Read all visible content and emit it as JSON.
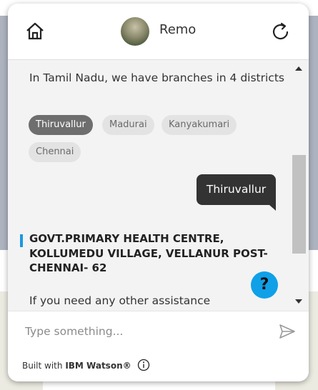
{
  "header": {
    "bot_name": "Remo",
    "home_icon": "home-icon",
    "refresh_icon": "refresh-icon"
  },
  "messages": {
    "branches_text": "In Tamil Nadu, we have branches in 4 districts",
    "district_options": [
      "Thiruvallur",
      "Madurai",
      "Kanyakumari",
      "Chennai"
    ],
    "selected_option": "Thiruvallur",
    "user_reply": "Thiruvallur",
    "address_lines": [
      "GOVT.PRIMARY HEALTH CENTRE,",
      "KOLLUMEDU VILLAGE, VELLANUR POST-",
      "CHENNAI- 62"
    ],
    "assist_text": "If you need any other assistance"
  },
  "help_button": {
    "label": "?"
  },
  "input": {
    "placeholder": "Type something..."
  },
  "footer": {
    "prefix": "Built with ",
    "brand": "IBM Watson®"
  },
  "colors": {
    "accent": "#1a98e0",
    "help_button": "#0fa0e8",
    "bubble": "#333333",
    "chip_selected": "#6e6e6e"
  }
}
